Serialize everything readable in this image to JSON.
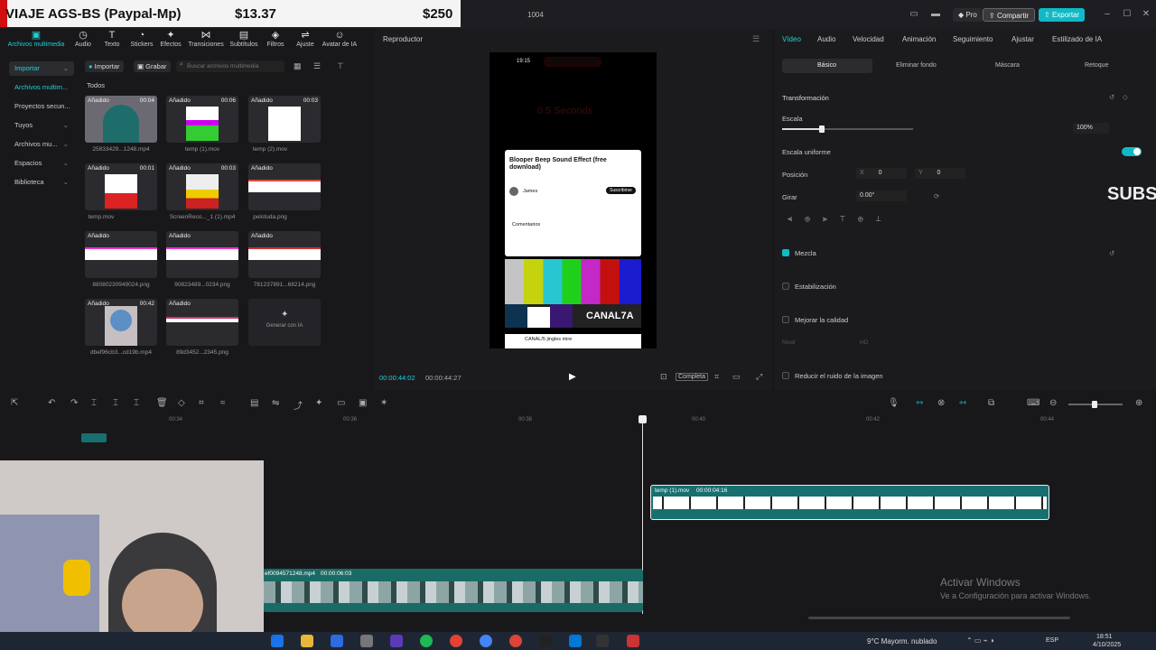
{
  "donation": {
    "title": "VIAJE AGS-BS (Paypal-Mp)",
    "amount1": "$13.37",
    "amount2": "$250"
  },
  "window": {
    "title": "1004",
    "pro_label": "Pro",
    "share_label": "Compartir",
    "export_label": "Exportar"
  },
  "toolbar": {
    "items": [
      "Archivos multimedia",
      "Audio",
      "Texto",
      "Stickers",
      "Efectos",
      "Transiciones",
      "Subtítulos",
      "Filtros",
      "Ajuste",
      "Avatar de IA"
    ]
  },
  "sidebar": {
    "items": [
      "Importar",
      "Archivos multim...",
      "Proyectos secun...",
      "Tuyos",
      "Archivos mu...",
      "Espacios",
      "Biblioteca"
    ]
  },
  "media": {
    "import_label": "Importar",
    "record_label": "Grabar",
    "search_placeholder": "Buscar archivos multimedia",
    "filter_label": "Todos",
    "added": "Añadido",
    "generate_label": "Generar con IA",
    "items": [
      {
        "name": "25833429...1248.mp4",
        "dur": "00:04"
      },
      {
        "name": "temp (1).mov",
        "dur": "00:06"
      },
      {
        "name": "temp (2).mov",
        "dur": "00:03"
      },
      {
        "name": "temp.mov",
        "dur": "00:01"
      },
      {
        "name": "ScreenReco..._1 (1).mp4",
        "dur": "00:03"
      },
      {
        "name": "pelotuda.png",
        "dur": ""
      },
      {
        "name": "88080230949024.png",
        "dur": ""
      },
      {
        "name": "90823489...0234.png",
        "dur": ""
      },
      {
        "name": "78123789​1...68214.png",
        "dur": ""
      },
      {
        "name": "dbef96cb3...cd19b.mp4",
        "dur": "00:42"
      },
      {
        "name": "89d3452...2345.png",
        "dur": ""
      }
    ]
  },
  "player": {
    "title": "Reproductor",
    "time_current": "00:00:44:02",
    "time_total": "00:00:44:27",
    "complete_label": "Completa",
    "phone_time": "19:15",
    "overlay_text": "0.5 Seconds",
    "video_title": "Blooper Beep Sound Effect (free download)",
    "channel": "James",
    "subscribe": "Suscribirse",
    "comments": "Comentarios",
    "brand": "CANAL7A",
    "bottom_caption": "CANAL/5 jingles mire"
  },
  "props": {
    "tabs": [
      "Vídeo",
      "Audio",
      "Velocidad",
      "Animación",
      "Seguimiento",
      "Ajustar",
      "Estilizado de IA"
    ],
    "subtabs": [
      "Básico",
      "Eliminar fondo",
      "Máscara",
      "Retoque"
    ],
    "transform": "Transformación",
    "scale_label": "Escala",
    "scale_value": "100%",
    "scale_fraction": 0.3,
    "uniform_label": "Escala uniforme",
    "position_label": "Posición",
    "pos_x_label": "X",
    "pos_x": "0",
    "pos_y_label": "Y",
    "pos_y": "0",
    "rotate_label": "Girar",
    "rotate_value": "0.00°",
    "blend": "Mezcla",
    "stabilize": "Estabilización",
    "enhance": "Mejorar la calidad",
    "level_label": "Nivel",
    "level_value": "HD",
    "denoise": "Reducir el ruido de la imagen",
    "subs_overlay": "SUBS"
  },
  "timeline": {
    "ticks": [
      "00:34",
      "00:36",
      "00:38",
      "00:40",
      "00:42",
      "00:44"
    ],
    "clip1": {
      "name": "temp (1).mov",
      "dur": "00:00:04:16"
    },
    "clip2": {
      "name": "ef0094571248.mp4",
      "dur": "00:00:06:03"
    }
  },
  "watermark": {
    "line1": "Activar Windows",
    "line2": "Ve a Configuración para activar Windows."
  },
  "taskbar": {
    "weather": "9°C  Mayorm. nublado",
    "lang": "ESP",
    "time": "18:51",
    "date": "4/10/2025"
  }
}
